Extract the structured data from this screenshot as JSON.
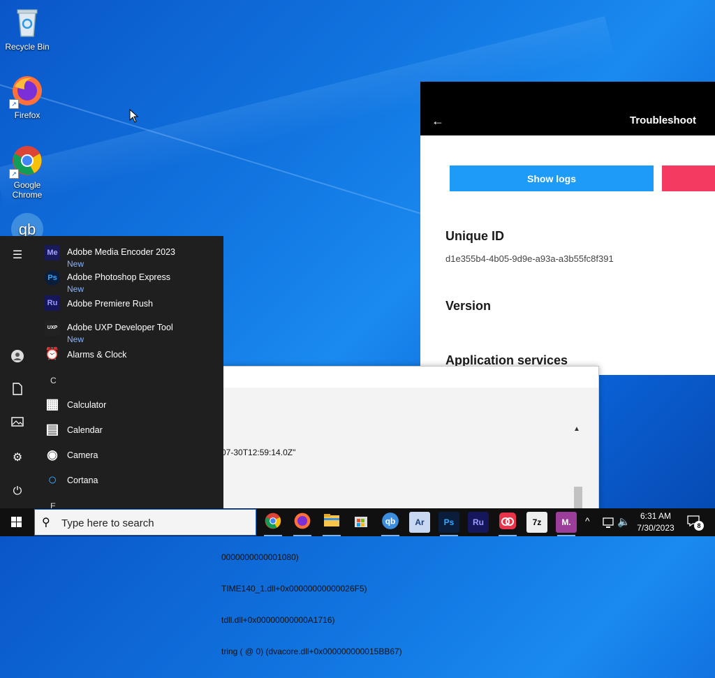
{
  "desktop": {
    "icons": [
      {
        "label": "Recycle Bin"
      },
      {
        "label": "Firefox"
      },
      {
        "label": "Google Chrome"
      }
    ]
  },
  "troubleshoot": {
    "title": "Troubleshoot",
    "show_logs_label": "Show logs",
    "unique_id_heading": "Unique ID",
    "unique_id_value": "d1e355b4-4b05-9d9e-a93a-a3b55fc8f391",
    "version_heading": "Version",
    "app_services_heading": "Application services"
  },
  "log": {
    "lines": [
      "07-30T12:59:14.0Z\"",
      "",
      "",
      "-----------",
      "0000000000001080)",
      "TIME140_1.dll+0x00000000000026F5)",
      "tdll.dll+0x00000000000A1716)",
      "tring ( @ 0) (dvacore.dll+0x000000000015BB67)"
    ]
  },
  "start_menu": {
    "apps": [
      {
        "icon": "Me",
        "name": "Adobe Media Encoder 2023",
        "badge": "New",
        "color": "#1a1a5a",
        "fg": "#a0a0ff"
      },
      {
        "icon": "Ps",
        "name": "Adobe Photoshop Express",
        "badge": "New",
        "color": "#0a1e3c",
        "fg": "#31a8ff"
      },
      {
        "icon": "Ru",
        "name": "Adobe Premiere Rush",
        "badge": "",
        "color": "#16165a",
        "fg": "#9a9aff"
      },
      {
        "icon": "UXP",
        "name": "Adobe UXP Developer Tool",
        "badge": "New",
        "color": "#222222",
        "fg": "#ffffff"
      },
      {
        "icon": "⏰",
        "name": "Alarms & Clock",
        "badge": "",
        "color": "transparent",
        "fg": "#ffffff"
      },
      {
        "icon": "▦",
        "name": "Calculator",
        "badge": "",
        "color": "transparent",
        "fg": "#ffffff"
      },
      {
        "icon": "▤",
        "name": "Calendar",
        "badge": "",
        "color": "transparent",
        "fg": "#ffffff"
      },
      {
        "icon": "◉",
        "name": "Camera",
        "badge": "",
        "color": "transparent",
        "fg": "#ffffff"
      },
      {
        "icon": "○",
        "name": "Cortana",
        "badge": "",
        "color": "transparent",
        "fg": "#2fa8ff"
      }
    ],
    "letter_c": "C",
    "letter_e": "E"
  },
  "taskbar": {
    "search_placeholder": "Type here to search",
    "time": "6:31 AM",
    "date": "7/30/2023",
    "notification_count": "8"
  }
}
